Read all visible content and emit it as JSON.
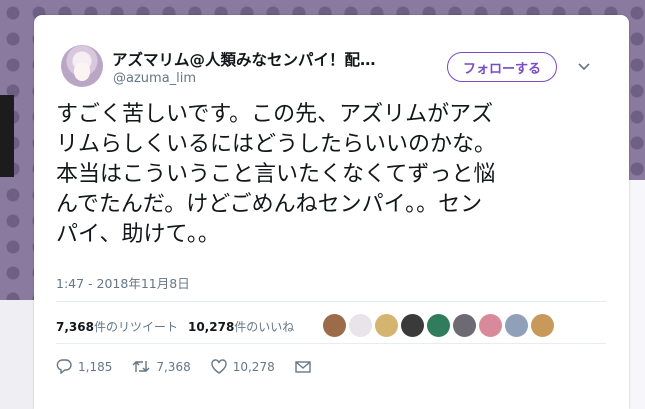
{
  "tweet": {
    "display_name": "アズマリム@人類みなセンパイ！配…",
    "handle": "@azuma_lim",
    "follow_label": "フォローする",
    "text_lines": [
      "すごく苦しいです。この先、アズリムがアズ",
      "リムらしくいるにはどうしたらいいのかな。",
      "本当はこういうこと言いたくなくてずっと悩",
      "んでたんだ。けどごめんねセンパイ。。セン",
      "パイ、助けて。。"
    ],
    "timestamp": "1:47 - 2018年11月8日",
    "retweet_count": "7,368",
    "retweet_label": "件のリツイート",
    "like_count": "10,278",
    "like_label": "件のいいね",
    "actions": {
      "reply_count": "1,185",
      "retweet_count": "7,368",
      "like_count": "10,278"
    }
  },
  "colors": {
    "accent": "#794bc4",
    "text": "#14171a",
    "muted": "#657786",
    "background_dots": "#8a7aa0"
  },
  "icons": [
    "chevron-down-icon",
    "reply-icon",
    "retweet-icon",
    "heart-icon",
    "message-icon"
  ]
}
